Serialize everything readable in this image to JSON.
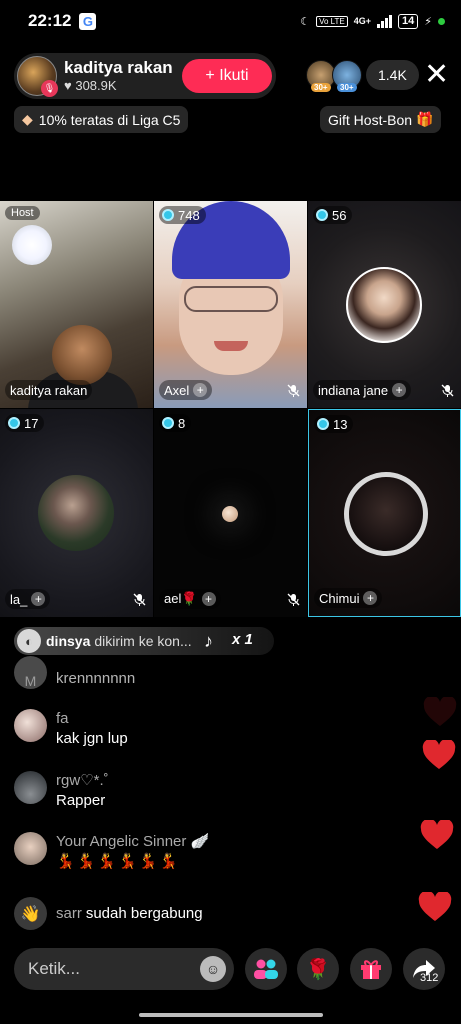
{
  "status_bar": {
    "time": "22:12",
    "network": "4G+",
    "battery": "14"
  },
  "host": {
    "name": "kaditya rakan",
    "likes": "308.9K",
    "follow_label": "+ Ikuti"
  },
  "viewers": {
    "count": "1.4K",
    "badges": [
      "30+",
      "30+"
    ]
  },
  "chips": {
    "league": "10% teratas di Liga C5",
    "gift_host": "Gift Host-Bon"
  },
  "grid": [
    {
      "tag": "Host",
      "name": "kaditya rakan",
      "count": null,
      "muted": false
    },
    {
      "tag": null,
      "name": "Axel",
      "count": "748",
      "muted": true
    },
    {
      "tag": null,
      "name": "indiana jane",
      "count": "56",
      "muted": true
    },
    {
      "tag": null,
      "name": "la_",
      "count": "17",
      "muted": true
    },
    {
      "tag": null,
      "name": "ael🌹",
      "count": "8",
      "muted": true
    },
    {
      "tag": null,
      "name": "Chimui",
      "count": "13",
      "muted": false
    }
  ],
  "gift_banner": {
    "user": "dinsya",
    "message": "dikirim ke kon...",
    "multiplier": "x 1"
  },
  "comments": [
    {
      "avatar": "M",
      "user": "",
      "text": "krennnnnnn"
    },
    {
      "user": "fa",
      "text": "kak jgn lup"
    },
    {
      "user": "rgw♡*.˚",
      "text": "Rapper"
    },
    {
      "user": "Your Angelic Sinner 🪽",
      "text": "💃💃💃💃💃💃"
    }
  ],
  "join_notice": {
    "user": "sarr",
    "text": "sudah bergabung"
  },
  "bottom_bar": {
    "placeholder": "Ketik...",
    "share_count": "312"
  },
  "colors": {
    "accent": "#fe2c55",
    "gem": "#34c6e8",
    "heart": "#e0282e",
    "selected_border": "#3cc6e6"
  }
}
